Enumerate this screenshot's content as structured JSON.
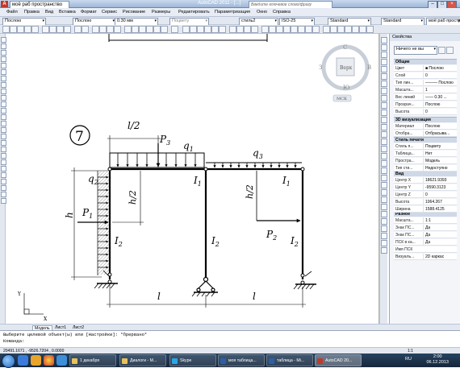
{
  "titlebar": {
    "workspace": "моё раб пространство",
    "title": "AutoCAD 2011 - [...]",
    "search_placeholder": "Введите ключевое слово/фразу"
  },
  "menu": [
    "Файл",
    "Правка",
    "Вид",
    "Вставка",
    "Формат",
    "Сервис",
    "Рисование",
    "Размеры",
    "Редактировать",
    "Параметризация",
    "Окно",
    "Справка"
  ],
  "toolbar": {
    "workspace_combo": "моё раб пространство",
    "layer_combo": "Послою",
    "linetype_combo": "Послою",
    "lineweight_combo": "0.30 мм",
    "plotstyle_combo": "Поцвету",
    "textstyle_combo": "Standard",
    "dimstyle_combo": "ISO-25",
    "tablestyle_combo": "Standard",
    "mleader_combo": "Standard",
    "layer_name": "стиль2"
  },
  "viewcube": {
    "top": "Верх",
    "north": "С",
    "south": "Ю",
    "west": "З",
    "east": "В",
    "ucs": "МСК"
  },
  "properties": {
    "title": "Свойства",
    "selection": "Ничего не вы",
    "sections": {
      "general": "Общие",
      "viz3d": "3D визуализация",
      "plot": "Стиль печати",
      "view": "Вид",
      "misc": "Разное"
    },
    "general_rows": [
      {
        "k": "Цвет",
        "v": "■ Послою"
      },
      {
        "k": "Слой",
        "v": "0"
      },
      {
        "k": "Тип лин...",
        "v": "——— Послою"
      },
      {
        "k": "Масшта...",
        "v": "1"
      },
      {
        "k": "Вес линий",
        "v": "—— 0.30 ..."
      },
      {
        "k": "Прозрач...",
        "v": "Послою"
      },
      {
        "k": "Высота",
        "v": "0"
      }
    ],
    "viz_rows": [
      {
        "k": "Материал",
        "v": "Послою"
      },
      {
        "k": "Отобра...",
        "v": "Отбрасыва..."
      }
    ],
    "plot_rows": [
      {
        "k": "Стиль п...",
        "v": "Поцвету"
      },
      {
        "k": "Таблица...",
        "v": "Нет"
      },
      {
        "k": "Простра...",
        "v": "Модель"
      },
      {
        "k": "Тип сти...",
        "v": "Недоступно"
      }
    ],
    "view_rows": [
      {
        "k": "Центр X",
        "v": "18621.9393"
      },
      {
        "k": "Центр Y",
        "v": "-9590.3123"
      },
      {
        "k": "Центр Z",
        "v": "0"
      },
      {
        "k": "Высота",
        "v": "1064.267"
      },
      {
        "k": "Ширина",
        "v": "1588.4125"
      }
    ],
    "misc_rows": [
      {
        "k": "Масшта...",
        "v": "1:1"
      },
      {
        "k": "Знак ПС...",
        "v": "Да"
      },
      {
        "k": "Знак ПС...",
        "v": "Да"
      },
      {
        "k": "ПСК в ка...",
        "v": "Да"
      },
      {
        "k": "Имя ПСК",
        "v": ""
      },
      {
        "k": "Визуаль...",
        "v": "2D каркас"
      }
    ]
  },
  "drawing": {
    "problem_number": "7",
    "dim_top": "l/2",
    "dim_left": "h",
    "dim_inner": "h/2",
    "dim_right_inner": "h/2",
    "dim_bottom_left": "l",
    "dim_bottom_right": "l",
    "loads": {
      "P3": "P",
      "P3_sub": "3",
      "q1": "q",
      "q1_sub": "1",
      "q2": "q",
      "q2_sub": "2",
      "q3": "q",
      "q3_sub": "3",
      "P1": "P",
      "P1_sub": "1",
      "P2": "P",
      "P2_sub": "2"
    },
    "stiffness": {
      "I1a": "I",
      "I1a_sub": "1",
      "I1b": "I",
      "I1b_sub": "1",
      "I2a": "I",
      "I2a_sub": "2",
      "I2b": "I",
      "I2b_sub": "2",
      "I2c": "I",
      "I2c_sub": "2"
    }
  },
  "ucs_axes": {
    "x": "X",
    "y": "Y"
  },
  "tabs": [
    "Модель",
    "Лист1",
    "Лист2"
  ],
  "command": {
    "line1": "Выберите целевой объект(ы) или [Настройки]: *Прервано*",
    "line2": "Команда:"
  },
  "status": {
    "coords": "20491.1671 , -9526.7204 , 0.0000",
    "scale": "1:1"
  },
  "taskbar": {
    "tasks": [
      {
        "label": "1 декабря",
        "color": "#e8c25a"
      },
      {
        "label": "Диалоги - М...",
        "color": "#e8c25a"
      },
      {
        "label": "Skype",
        "color": "#2aa6e6"
      },
      {
        "label": "моя таблица...",
        "color": "#2b5faa"
      },
      {
        "label": "таблица - Mi...",
        "color": "#2b5faa"
      },
      {
        "label": "AutoCAD 20...",
        "color": "#c0392b"
      }
    ],
    "lang": "RU",
    "time": "2:00",
    "date": "06.12.2013"
  }
}
